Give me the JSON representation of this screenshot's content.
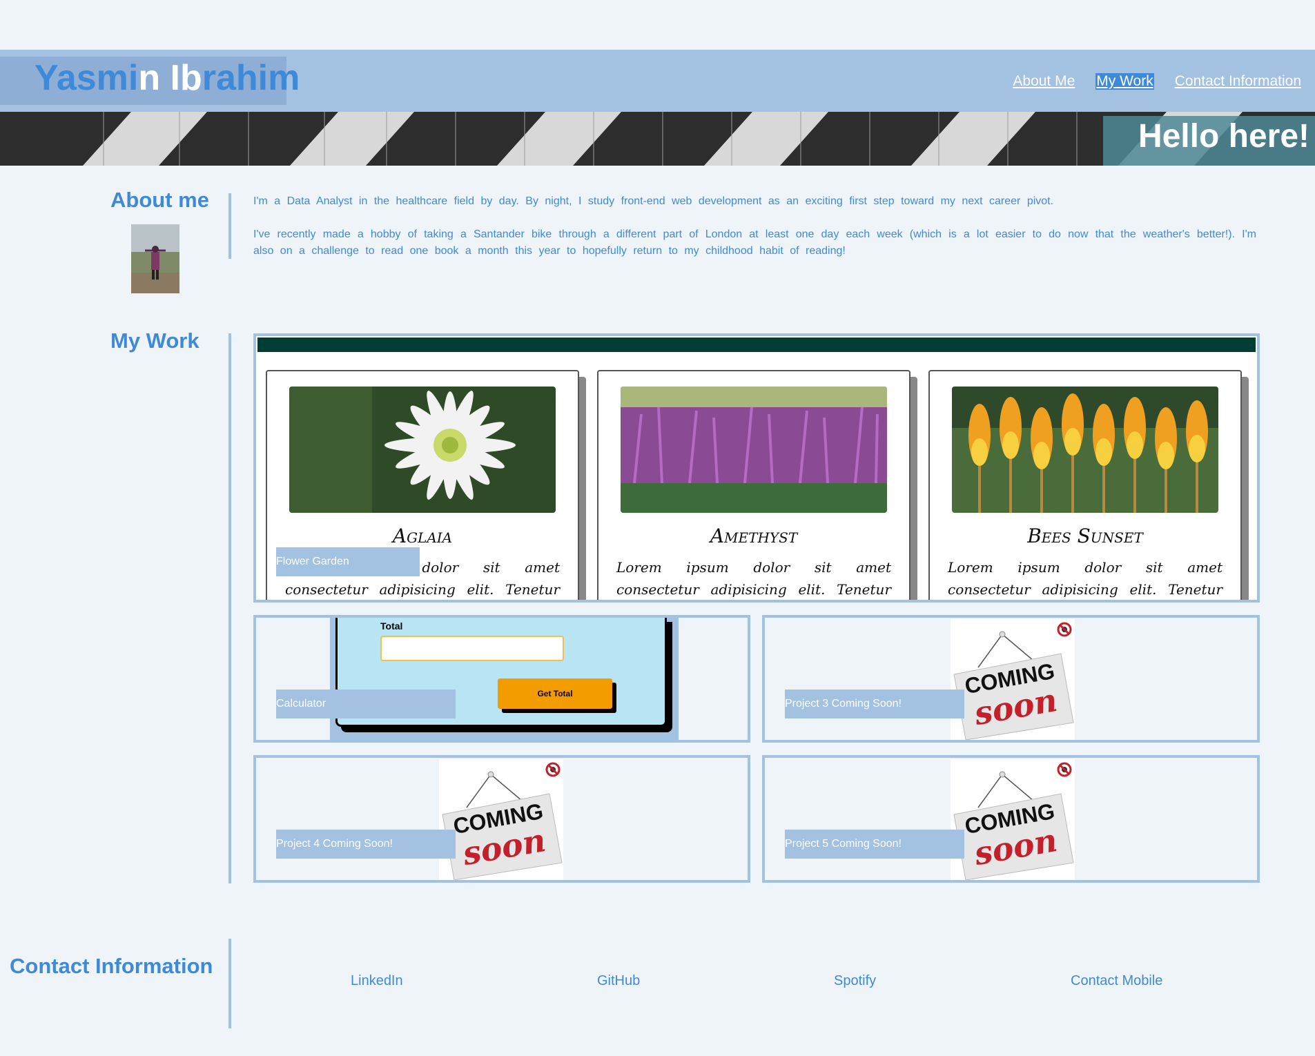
{
  "header": {
    "logo_part_a": "Yasmi",
    "logo_part_b": "n Ib",
    "logo_part_c": "rahim",
    "nav": [
      {
        "label": "About Me"
      },
      {
        "label": "My Work"
      },
      {
        "label": "Contact Information"
      }
    ]
  },
  "banner": {
    "greeting": "Hello here!"
  },
  "about": {
    "title": "About me",
    "paragraphs": [
      "I'm a Data Analyst in the healthcare field by day. By night, I study front-end web development as an exciting first step toward my next career pivot.",
      "I've recently made a hobby of taking a Santander bike through a different part of London at least one day each week (which is a lot easier to do now that the weather's better!). I'm also on a challenge to read one book a month this year to hopefully return to my childhood habit of reading!"
    ]
  },
  "work": {
    "title": "My Work",
    "garden": {
      "label": "Flower Garden",
      "cards": [
        {
          "name": "Aglaia",
          "text": "Lorem ipsum dolor sit amet consectetur adipisicing elit. Tenetur recusandae sed"
        },
        {
          "name": "Amethyst",
          "text": "Lorem ipsum dolor sit amet consectetur adipisicing elit. Tenetur recusandae sed"
        },
        {
          "name": "Bees Sunset",
          "text": "Lorem ipsum dolor sit amet consectetur adipisicing elit. Tenetur recusandae sed"
        }
      ]
    },
    "calculator": {
      "label": "Calculator",
      "total_label": "Total",
      "button": "Get Total"
    },
    "projects": [
      {
        "label": "Project 3 Coming Soon!",
        "sign_top": "COMING",
        "sign_bottom": "SOON"
      },
      {
        "label": "Project 4 Coming Soon!",
        "sign_top": "COMING",
        "sign_bottom": "SOON"
      },
      {
        "label": "Project 5 Coming Soon!",
        "sign_top": "COMING",
        "sign_bottom": "SOON"
      }
    ]
  },
  "contact": {
    "title": "Contact Information",
    "links": [
      "LinkedIn",
      "GitHub",
      "Spotify",
      "Contact Mobile"
    ]
  },
  "colors": {
    "accent": "#3f8ad8",
    "header_bg": "#a3c1e0",
    "page_bg": "#eff4f9",
    "garden_bar": "#003d35",
    "calc_button": "#f39c00"
  }
}
